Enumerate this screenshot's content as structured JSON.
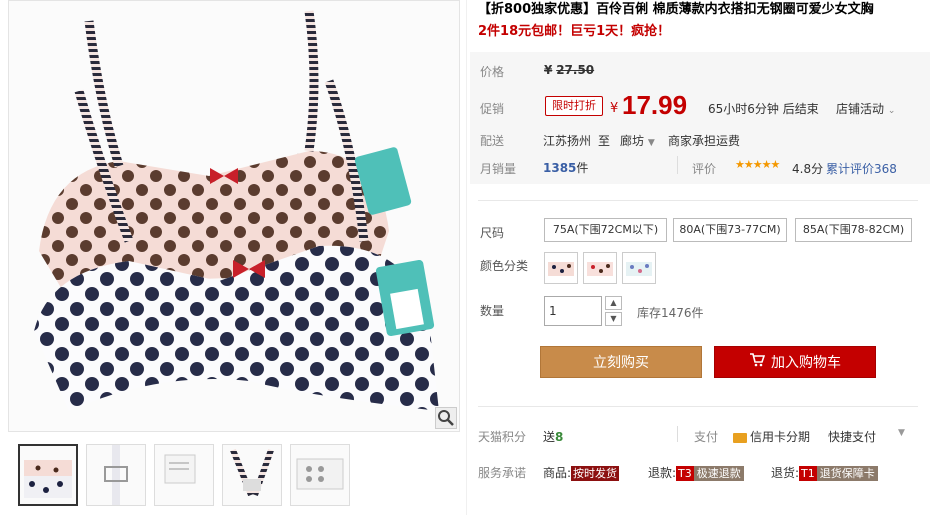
{
  "product": {
    "title": "【折800独家优惠】百伶百俐 棉质薄款内衣搭扣无钢圈可爱少女文胸",
    "subtitle": "2件18元包邮！巨亏1天！疯抢！"
  },
  "price": {
    "label": "价格",
    "currency": "¥",
    "original": "27.50"
  },
  "promo": {
    "label": "促销",
    "tag": "限时打折",
    "currency": "¥",
    "price": "17.99",
    "countdown": "65小时6分钟 后结束",
    "shop_activity": "店铺活动"
  },
  "shipping": {
    "label": "配送",
    "from": "江苏扬州",
    "to_word": "至",
    "destination": "廊坊",
    "fee": "商家承担运费"
  },
  "sales": {
    "label": "月销量",
    "count": "1385",
    "unit": "件",
    "rating_label": "评价",
    "stars": "★★★★★",
    "score": "4.8分",
    "reviews": "累计评价368"
  },
  "size": {
    "label": "尺码",
    "options": [
      "75A(下围72CM以下)",
      "80A(下围73-77CM)",
      "85A(下围78-82CM)"
    ]
  },
  "color": {
    "label": "颜色分类"
  },
  "quantity": {
    "label": "数量",
    "value": "1",
    "up": "▲",
    "down": "▼",
    "stock": "库存1476件"
  },
  "actions": {
    "buy_now": "立刻购买",
    "add_cart": "加入购物车"
  },
  "points": {
    "label": "天猫积分",
    "send": "送",
    "value": "8",
    "pay_label": "支付",
    "credit": "信用卡分期",
    "fast_pay": "快捷支付"
  },
  "service": {
    "label": "服务承诺",
    "goods": "商品:",
    "goods_badge": "按时发货",
    "refund": "退款:",
    "refund_badge": "T3",
    "refund_text": "极速退款",
    "return": "退货:",
    "return_badge": "T1",
    "return_text": "退货保障卡"
  },
  "colors": {
    "accent_red": "#c40000",
    "buy_now_bg": "#c88b4a",
    "link_blue": "#3a5fa5"
  }
}
